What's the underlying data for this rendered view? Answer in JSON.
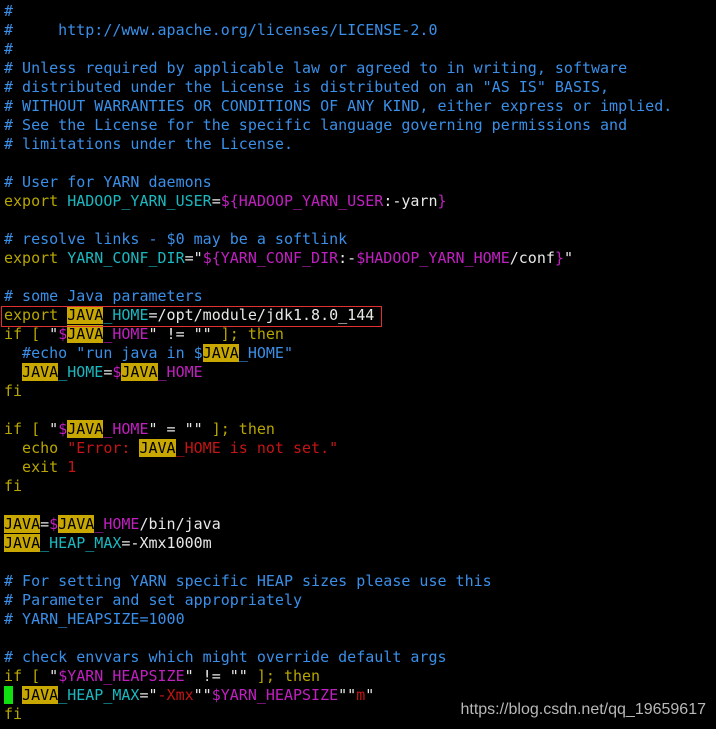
{
  "editor": {
    "colors": {
      "comment": "#3a8fe8",
      "keyword": "#b8a600",
      "variable": "#1ab8c0",
      "expansion": "#c020c0",
      "string": "#c41414",
      "search_highlight": "#c8a800",
      "cursor": "#10e010",
      "selection_box": "#e03030"
    },
    "lines": [
      [
        [
          "#",
          "c"
        ]
      ],
      [
        [
          "#     http://www.apache.org/licenses/LICENSE-2.0",
          "c"
        ]
      ],
      [
        [
          "#",
          "c"
        ]
      ],
      [
        [
          "# Unless required by applicable law or agreed to in writing, software",
          "c"
        ]
      ],
      [
        [
          "# distributed under the License is distributed on an \"AS IS\" BASIS,",
          "c"
        ]
      ],
      [
        [
          "# WITHOUT WARRANTIES OR CONDITIONS OF ANY KIND, either express or implied.",
          "c"
        ]
      ],
      [
        [
          "# See the License for the specific language governing permissions and",
          "c"
        ]
      ],
      [
        [
          "# limitations under the License.",
          "c"
        ]
      ],
      [],
      [
        [
          "# User for YARN daemons",
          "c"
        ]
      ],
      [
        [
          "export",
          "k"
        ],
        [
          " ",
          "w"
        ],
        [
          "HADOOP_YARN_USER",
          "v"
        ],
        [
          "=",
          "w"
        ],
        [
          "${HADOOP_YARN_USER",
          "m"
        ],
        [
          ":-yarn",
          "w"
        ],
        [
          "}",
          "m"
        ]
      ],
      [],
      [
        [
          "# resolve links - $0 may be a softlink",
          "c"
        ]
      ],
      [
        [
          "export",
          "k"
        ],
        [
          " ",
          "w"
        ],
        [
          "YARN_CONF_DIR",
          "v"
        ],
        [
          "=\"",
          "w"
        ],
        [
          "${YARN_CONF_DIR",
          "m"
        ],
        [
          ":-",
          "w"
        ],
        [
          "$HADOOP_YARN_HOME",
          "m"
        ],
        [
          "/conf",
          "w"
        ],
        [
          "}",
          "m"
        ],
        [
          "\"",
          "w"
        ]
      ],
      [],
      [
        [
          "# some Java parameters",
          "c"
        ]
      ],
      [
        [
          "export",
          "k"
        ],
        [
          " ",
          "w"
        ],
        [
          "JAVA",
          "h"
        ],
        [
          "_HOME",
          "v"
        ],
        [
          "=/opt/module/jdk1.8.0_144",
          "w"
        ]
      ],
      [
        [
          "if [ ",
          "k"
        ],
        [
          "\"",
          "w"
        ],
        [
          "$",
          "m"
        ],
        [
          "JAVA",
          "h"
        ],
        [
          "_HOME",
          "m"
        ],
        [
          "\" != \"\" ",
          "w"
        ],
        [
          "]; then",
          "k"
        ]
      ],
      [
        [
          "  #echo \"run java in $",
          "c"
        ],
        [
          "JAVA",
          "h"
        ],
        [
          "_HOME\"",
          "c"
        ]
      ],
      [
        [
          "  ",
          "w"
        ],
        [
          "JAVA",
          "h"
        ],
        [
          "_HOME",
          "v"
        ],
        [
          "=",
          "w"
        ],
        [
          "$",
          "m"
        ],
        [
          "JAVA",
          "h"
        ],
        [
          "_HOME",
          "m"
        ]
      ],
      [
        [
          "fi",
          "k"
        ]
      ],
      [],
      [
        [
          "if [ ",
          "k"
        ],
        [
          "\"",
          "w"
        ],
        [
          "$",
          "m"
        ],
        [
          "JAVA",
          "h"
        ],
        [
          "_HOME",
          "m"
        ],
        [
          "\" = \"\" ",
          "w"
        ],
        [
          "]; then",
          "k"
        ]
      ],
      [
        [
          "  echo ",
          "k"
        ],
        [
          "\"Error: ",
          "s"
        ],
        [
          "JAVA",
          "h"
        ],
        [
          "_HOME is not set.\"",
          "s"
        ]
      ],
      [
        [
          "  exit ",
          "k"
        ],
        [
          "1",
          "s"
        ]
      ],
      [
        [
          "fi",
          "k"
        ]
      ],
      [],
      [
        [
          "JAVA",
          "h"
        ],
        [
          "=",
          "w"
        ],
        [
          "$",
          "m"
        ],
        [
          "JAVA",
          "h"
        ],
        [
          "_HOME",
          "m"
        ],
        [
          "/bin/java",
          "w"
        ]
      ],
      [
        [
          "JAVA",
          "h"
        ],
        [
          "_HEAP_MAX",
          "v"
        ],
        [
          "=-Xmx1000m",
          "w"
        ]
      ],
      [],
      [
        [
          "# For setting YARN specific HEAP sizes please use this",
          "c"
        ]
      ],
      [
        [
          "# Parameter and set appropriately",
          "c"
        ]
      ],
      [
        [
          "# YARN_HEAPSIZE=1000",
          "c"
        ]
      ],
      [],
      [
        [
          "# check envvars which might override default args",
          "c"
        ]
      ],
      [
        [
          "if [ ",
          "k"
        ],
        [
          "\"",
          "w"
        ],
        [
          "$YARN_HEAPSIZE",
          "m"
        ],
        [
          "\" != \"\" ",
          "w"
        ],
        [
          "]; then",
          "k"
        ]
      ],
      [
        [
          " ",
          "cur"
        ],
        [
          " ",
          "w"
        ],
        [
          "JAVA",
          "h"
        ],
        [
          "_HEAP_MAX",
          "v"
        ],
        [
          "=\"",
          "w"
        ],
        [
          "-Xmx",
          "s"
        ],
        [
          "\"\"",
          "w"
        ],
        [
          "$YARN_HEAPSIZE",
          "m"
        ],
        [
          "\"\"",
          "w"
        ],
        [
          "m",
          "s"
        ],
        [
          "\"",
          "w"
        ]
      ],
      [
        [
          "fi",
          "k"
        ]
      ]
    ]
  },
  "watermark": "https://blog.csdn.net/qq_19659617"
}
